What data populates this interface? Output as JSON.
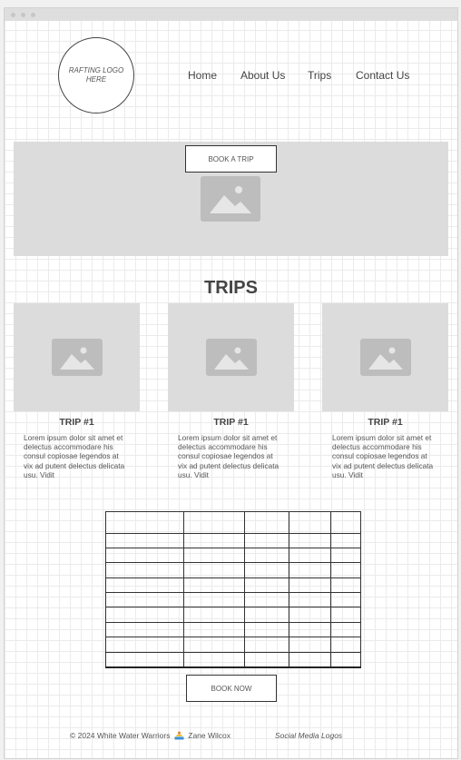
{
  "logo": {
    "text": "RAFTING LOGO HERE"
  },
  "nav": {
    "items": [
      {
        "label": "Home"
      },
      {
        "label": "About Us"
      },
      {
        "label": "Trips"
      },
      {
        "label": "Contact Us"
      }
    ]
  },
  "hero": {
    "button_label": "BOOK A TRIP"
  },
  "trips": {
    "title": "TRIPS",
    "cards": [
      {
        "title": "TRIP #1",
        "text": "Lorem ipsum dolor sit amet et delectus accommodare his consul copiosae legendos at vix ad putent delectus delicata usu. Vidit"
      },
      {
        "title": "TRIP #1",
        "text": "Lorem ipsum dolor sit amet et delectus accommodare his consul copiosae legendos at vix ad putent delectus delicata usu. Vidit"
      },
      {
        "title": "TRIP #1",
        "text": "Lorem ipsum dolor sit amet et delectus accommodare his consul copiosae legendos at vix ad putent delectus delicata usu. Vidit"
      }
    ]
  },
  "table": {
    "rows": 10,
    "cols": 5
  },
  "booking": {
    "button_label": "BOOK NOW"
  },
  "footer": {
    "copyright": "© 2024 White Water Warriors",
    "author": "Zane Wilcox",
    "social": "Social Media Logos"
  }
}
